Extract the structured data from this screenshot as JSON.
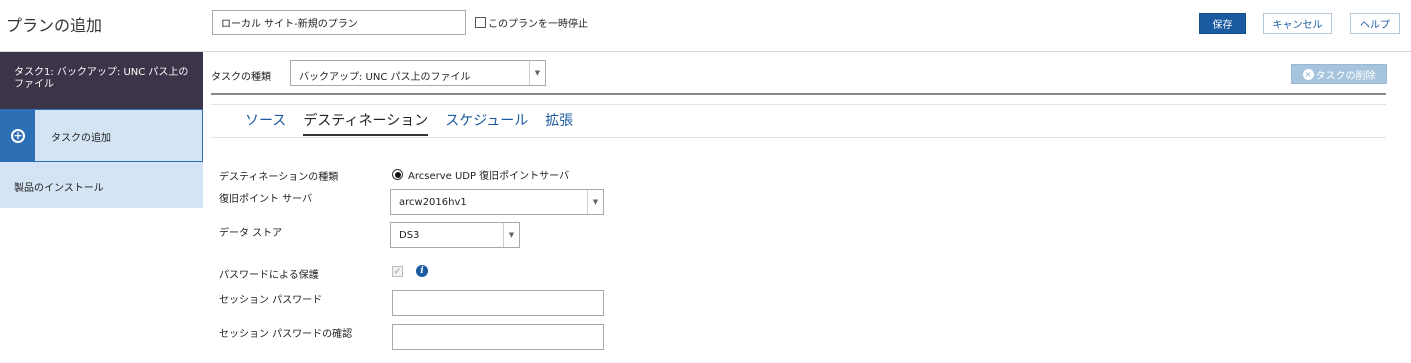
{
  "header": {
    "title": "プランの追加",
    "plan_name": "ローカル サイト-新規のプラン",
    "pause_label": "このプランを一時停止",
    "save_label": "保存",
    "cancel_label": "キャンセル",
    "help_label": "ヘルプ"
  },
  "sidebar": {
    "task_label": "タスク1: バックアップ: UNC パス上の\nファイル",
    "add_task_label": "タスクの追加",
    "install_label": "製品のインストール"
  },
  "main": {
    "task_type_label": "タスクの種類",
    "task_type_value": "バックアップ: UNC パス上のファイル",
    "delete_task_label": "タスクの削除",
    "tabs": [
      {
        "label": "ソース",
        "active": false
      },
      {
        "label": "デスティネーション",
        "active": true
      },
      {
        "label": "スケジュール",
        "active": false
      },
      {
        "label": "拡張",
        "active": false
      }
    ],
    "form": {
      "destination_type_label": "デスティネーションの種類",
      "destination_type_option": "Arcserve UDP 復旧ポイントサーバ",
      "rps_label": "復旧ポイント サーバ",
      "rps_value": "arcw2016hv1",
      "datastore_label": "データ ストア",
      "datastore_value": "DS3",
      "password_protect_label": "パスワードによる保護",
      "session_password_label": "セッション パスワード",
      "session_password_value": "",
      "session_password_confirm_label": "セッション パスワードの確認",
      "session_password_confirm_value": ""
    }
  },
  "colors": {
    "primary": "#1a5aa0",
    "sidebar_dark": "#3c3448",
    "sidebar_light": "#d4e4f4",
    "delete_disabled": "#a6c4dd"
  },
  "icons": {
    "add_task": "plus-circle-icon",
    "delete_task": "x-circle-icon",
    "info": "info-icon",
    "dropdown": "chevron-down-icon"
  }
}
